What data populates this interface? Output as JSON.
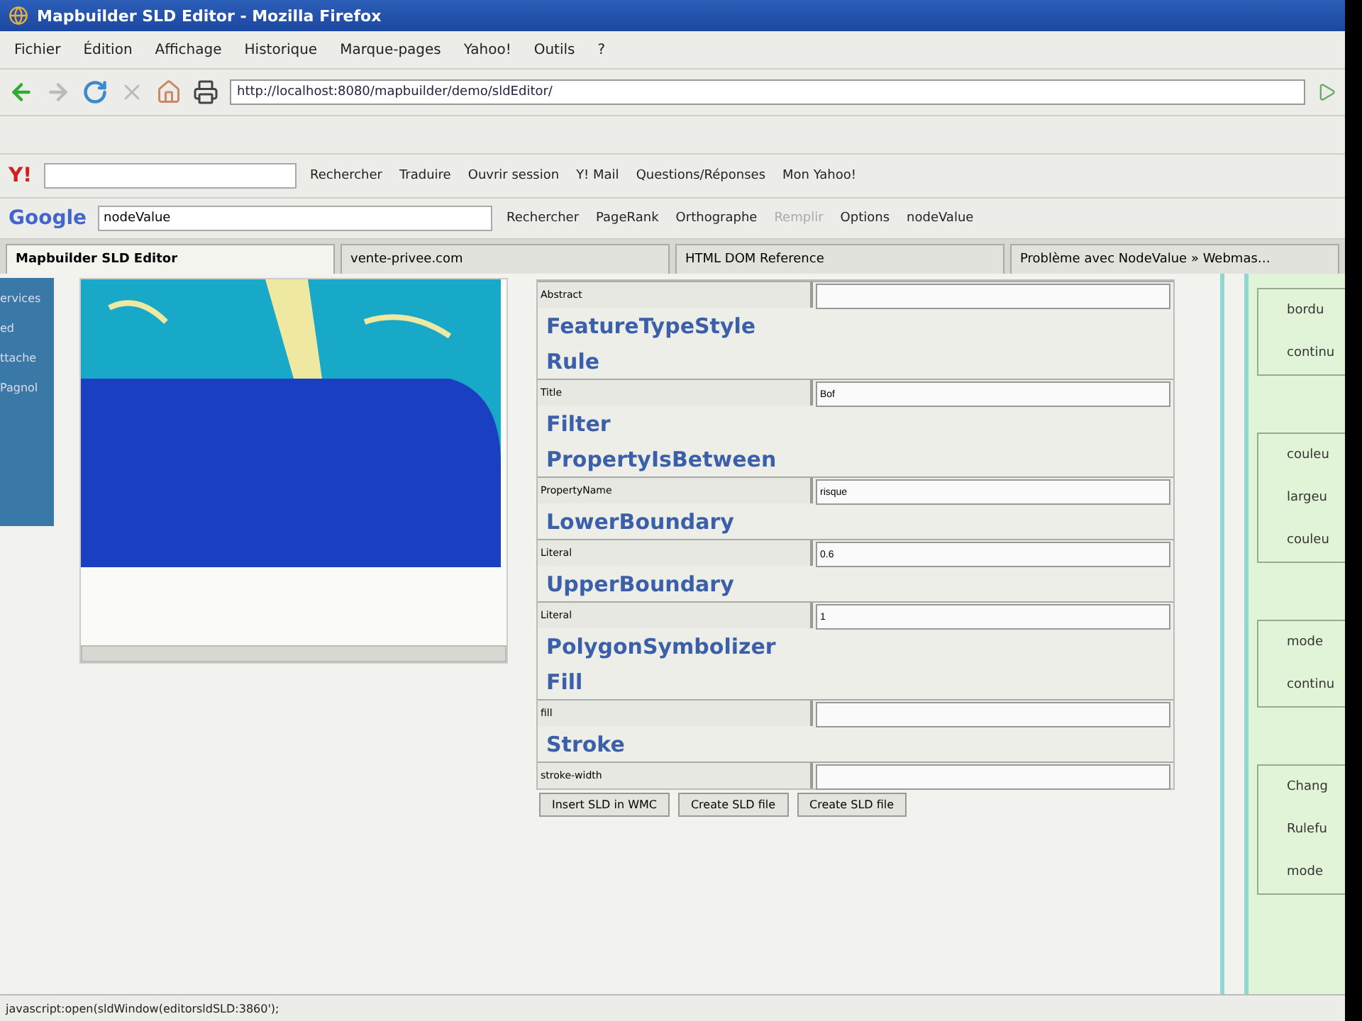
{
  "window": {
    "title": "Mapbuilder SLD Editor - Mozilla Firefox"
  },
  "menu": [
    "Fichier",
    "Édition",
    "Affichage",
    "Historique",
    "Marque-pages",
    "Yahoo!",
    "Outils",
    "?"
  ],
  "address": {
    "value": "http://localhost:8080/mapbuilder/demo/sldEditor/"
  },
  "yahoo_toolbar": {
    "logo": "Y!",
    "items": [
      {
        "label": "Rechercher",
        "disabled": false
      },
      {
        "label": "Traduire",
        "disabled": false
      },
      {
        "label": "Ouvrir session",
        "disabled": false
      },
      {
        "label": "Y! Mail",
        "disabled": false
      },
      {
        "label": "Questions/Réponses",
        "disabled": false
      },
      {
        "label": "Mon Yahoo!",
        "disabled": false
      }
    ]
  },
  "google_toolbar": {
    "logo": "Google",
    "search_value": "nodeValue",
    "items": [
      {
        "label": "Rechercher",
        "disabled": false
      },
      {
        "label": "PageRank",
        "disabled": false
      },
      {
        "label": "Orthographe",
        "disabled": false
      },
      {
        "label": "Remplir",
        "disabled": true
      },
      {
        "label": "Options",
        "disabled": false
      },
      {
        "label": "nodeValue",
        "disabled": false
      }
    ]
  },
  "tabs": [
    {
      "label": "Mapbuilder SLD Editor",
      "selected": true
    },
    {
      "label": "vente-privee.com",
      "selected": false
    },
    {
      "label": "HTML DOM Reference",
      "selected": false
    },
    {
      "label": "Problème avec NodeValue » Webmas…",
      "selected": false
    }
  ],
  "sidebar": {
    "items": [
      "ervices",
      "ed",
      "ttache",
      "Pagnol"
    ]
  },
  "form": {
    "rows": [
      {
        "kind": "field",
        "label": "Abstract",
        "value": ""
      },
      {
        "kind": "heading",
        "label": "FeatureTypeStyle"
      },
      {
        "kind": "heading",
        "label": "Rule"
      },
      {
        "kind": "field",
        "label": "Title",
        "value": "Bof"
      },
      {
        "kind": "heading",
        "label": "Filter"
      },
      {
        "kind": "heading",
        "label": "PropertyIsBetween"
      },
      {
        "kind": "field",
        "label": "PropertyName",
        "value": "risque"
      },
      {
        "kind": "heading",
        "label": "LowerBoundary"
      },
      {
        "kind": "field",
        "label": "Literal",
        "value": "0.6"
      },
      {
        "kind": "heading",
        "label": "UpperBoundary"
      },
      {
        "kind": "field",
        "label": "Literal",
        "value": "1"
      },
      {
        "kind": "heading",
        "label": "PolygonSymbolizer"
      },
      {
        "kind": "heading",
        "label": "Fill"
      },
      {
        "kind": "field",
        "label": "fill",
        "value": ""
      },
      {
        "kind": "heading",
        "label": "Stroke"
      },
      {
        "kind": "field",
        "label": "stroke-width",
        "value": ""
      }
    ],
    "buttons": [
      "Insert SLD in WMC",
      "Create SLD file",
      "Create SLD file"
    ]
  },
  "right_panel": {
    "boxes": [
      [
        "bordu",
        "continu"
      ],
      [
        "couleu",
        "largeu",
        "couleu"
      ],
      [
        "mode",
        "continu"
      ],
      [
        "Chang",
        "Rulefu",
        "mode"
      ]
    ]
  },
  "status_bar": "javascript:open(sldWindow(editorsldSLD:3860');"
}
